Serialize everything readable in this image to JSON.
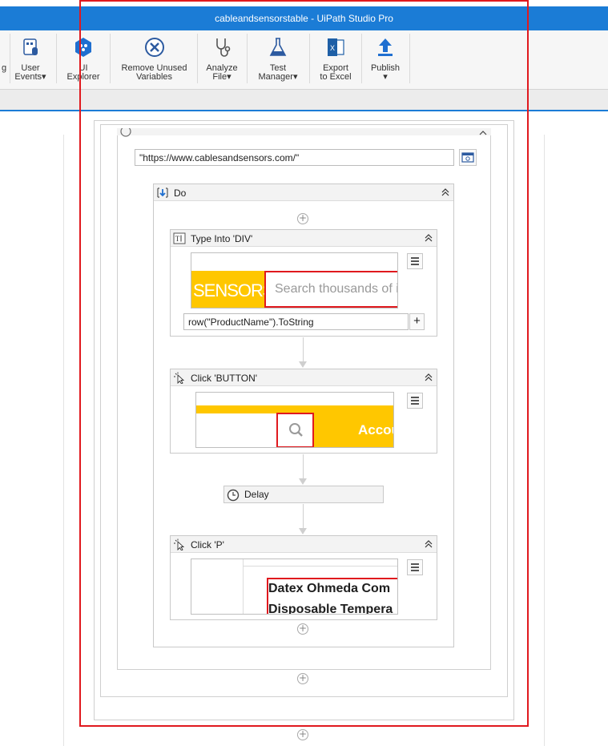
{
  "window": {
    "title": "cableandsensorstable - UiPath Studio Pro"
  },
  "ribbon": {
    "cut_label": "g",
    "buttons": [
      {
        "name": "user-events",
        "line1": "User",
        "line2": "Events"
      },
      {
        "name": "ui-explorer",
        "line1": "UI",
        "line2": "Explorer"
      },
      {
        "name": "remove-unused-variables",
        "line1": "Remove Unused",
        "line2": "Variables"
      },
      {
        "name": "analyze-file",
        "line1": "Analyze",
        "line2": "File"
      },
      {
        "name": "test-manager",
        "line1": "Test",
        "line2": "Manager"
      },
      {
        "name": "export-to-excel",
        "line1": "Export",
        "line2": "to Excel"
      },
      {
        "name": "publish",
        "line1": "Publish",
        "line2": ""
      }
    ],
    "dropdown_glyph": "▾"
  },
  "workflow": {
    "url_value": "\"https://www.cablesandsensors.com/\"",
    "do_label": "Do",
    "type_into": {
      "title": "Type Into 'DIV'",
      "preview_brand": "SENSORS",
      "preview_search_placeholder": "Search thousands of i",
      "text_value": "row(\"ProductName\").ToString",
      "add_label": "+"
    },
    "click_button": {
      "title": "Click 'BUTTON'",
      "preview_text": "Accou"
    },
    "delay": {
      "title": "Delay"
    },
    "click_p": {
      "title": "Click 'P'",
      "preview_line1": "Datex Ohmeda Com",
      "preview_line2": "Disposable Tempera"
    },
    "plus_glyph": "+"
  },
  "colors": {
    "titlebar": "#1b7cd6",
    "highlight": "#e0191e",
    "preview_yellow": "#ffc700"
  }
}
